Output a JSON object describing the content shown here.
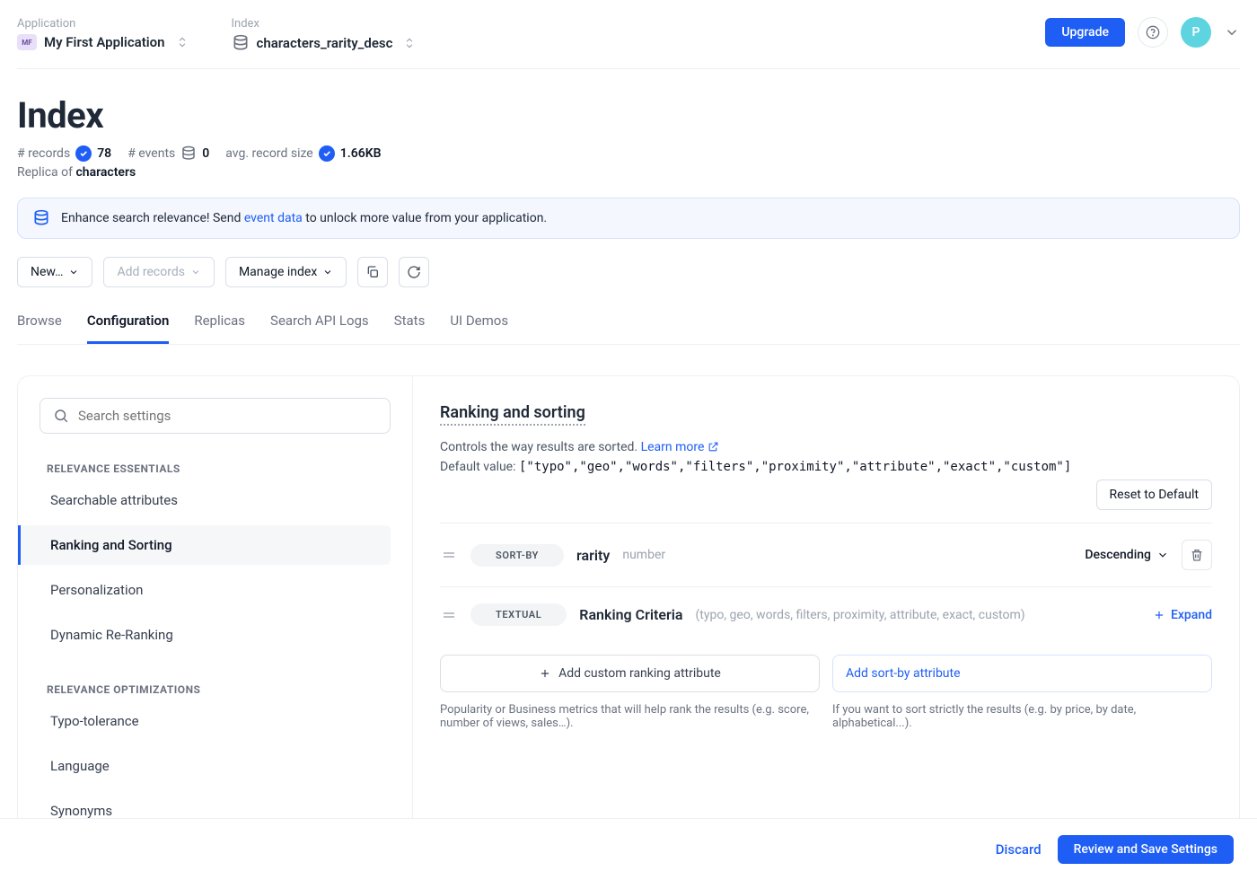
{
  "breadcrumbs": {
    "application_label": "Application",
    "application_value": "My First Application",
    "application_badge": "MF",
    "index_label": "Index",
    "index_value": "characters_rarity_desc"
  },
  "top_right": {
    "upgrade": "Upgrade",
    "avatar_initial": "P"
  },
  "page_title": "Index",
  "stats": {
    "records_label": "# records",
    "records_value": "78",
    "events_label": "# events",
    "events_value": "0",
    "avg_label": "avg. record size",
    "avg_value": "1.66KB"
  },
  "replica": {
    "prefix": "Replica of ",
    "name": "characters"
  },
  "banner": {
    "text_a": "Enhance search relevance! Send ",
    "link": "event data",
    "text_b": " to unlock more value from your application."
  },
  "toolbar": {
    "new": "New…",
    "add_records": "Add records",
    "manage": "Manage index"
  },
  "tabs": [
    "Browse",
    "Configuration",
    "Replicas",
    "Search API Logs",
    "Stats",
    "UI Demos"
  ],
  "active_tab": "Configuration",
  "sidebar": {
    "search_placeholder": "Search settings",
    "sections": [
      {
        "label": "RELEVANCE ESSENTIALS",
        "items": [
          "Searchable attributes",
          "Ranking and Sorting",
          "Personalization",
          "Dynamic Re-Ranking"
        ]
      },
      {
        "label": "RELEVANCE OPTIMIZATIONS",
        "items": [
          "Typo-tolerance",
          "Language",
          "Synonyms"
        ]
      }
    ],
    "active_item": "Ranking and Sorting"
  },
  "main": {
    "title": "Ranking and sorting",
    "desc": "Controls the way results are sorted. ",
    "learn_more": "Learn more",
    "default_label": "Default value: ",
    "default_value": "[\"typo\",\"geo\",\"words\",\"filters\",\"proximity\",\"attribute\",\"exact\",\"custom\"]",
    "reset": "Reset to Default",
    "criteria": [
      {
        "badge": "SORT-BY",
        "name": "rarity",
        "meta": "number",
        "order": "Descending",
        "deletable": true
      },
      {
        "badge": "TEXTUAL",
        "name": "Ranking Criteria",
        "meta": "(typo, geo, words, filters, proximity, attribute, exact, custom)",
        "expand": "Expand"
      }
    ],
    "add_custom": "Add custom ranking attribute",
    "add_sortby": "Add sort-by attribute",
    "help_custom": "Popularity or Business metrics that will help rank the results (e.g. score, number of views, sales…).",
    "help_sortby": "If you want to sort strictly the results (e.g. by price, by date, alphabetical...)."
  },
  "footer": {
    "discard": "Discard",
    "save": "Review and Save Settings"
  }
}
